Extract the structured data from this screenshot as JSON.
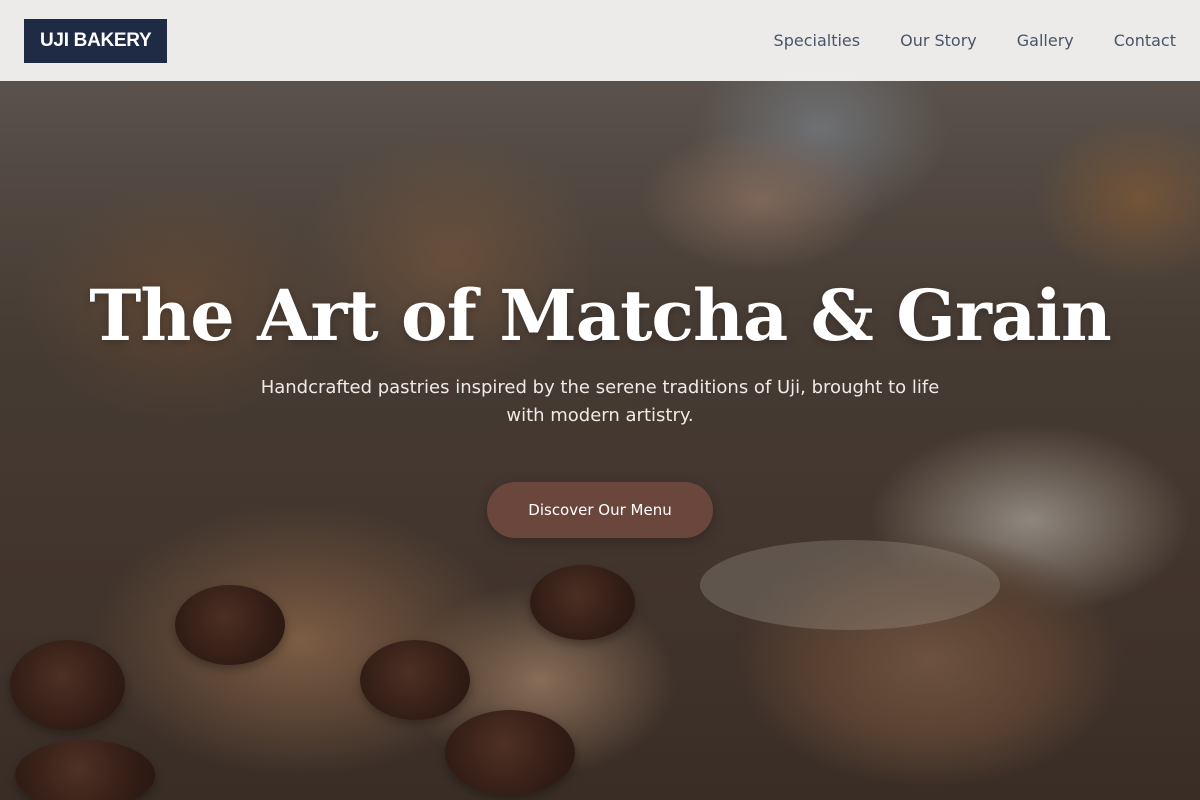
{
  "brand": {
    "logo_text": "UJI BAKERY"
  },
  "nav": {
    "links": [
      {
        "label": "Specialties"
      },
      {
        "label": "Our Story"
      },
      {
        "label": "Gallery"
      },
      {
        "label": "Contact"
      }
    ]
  },
  "hero": {
    "title": "The Art of Matcha & Grain",
    "subtitle": "Handcrafted pastries inspired by the serene traditions of Uji, brought to life with modern artistry.",
    "cta_label": "Discover Our Menu",
    "background_image": "bakery-pastries-photo"
  },
  "colors": {
    "logo_bg": "#1f2a44",
    "nav_text": "#4a5468",
    "cta_bg": "#6a463c"
  }
}
